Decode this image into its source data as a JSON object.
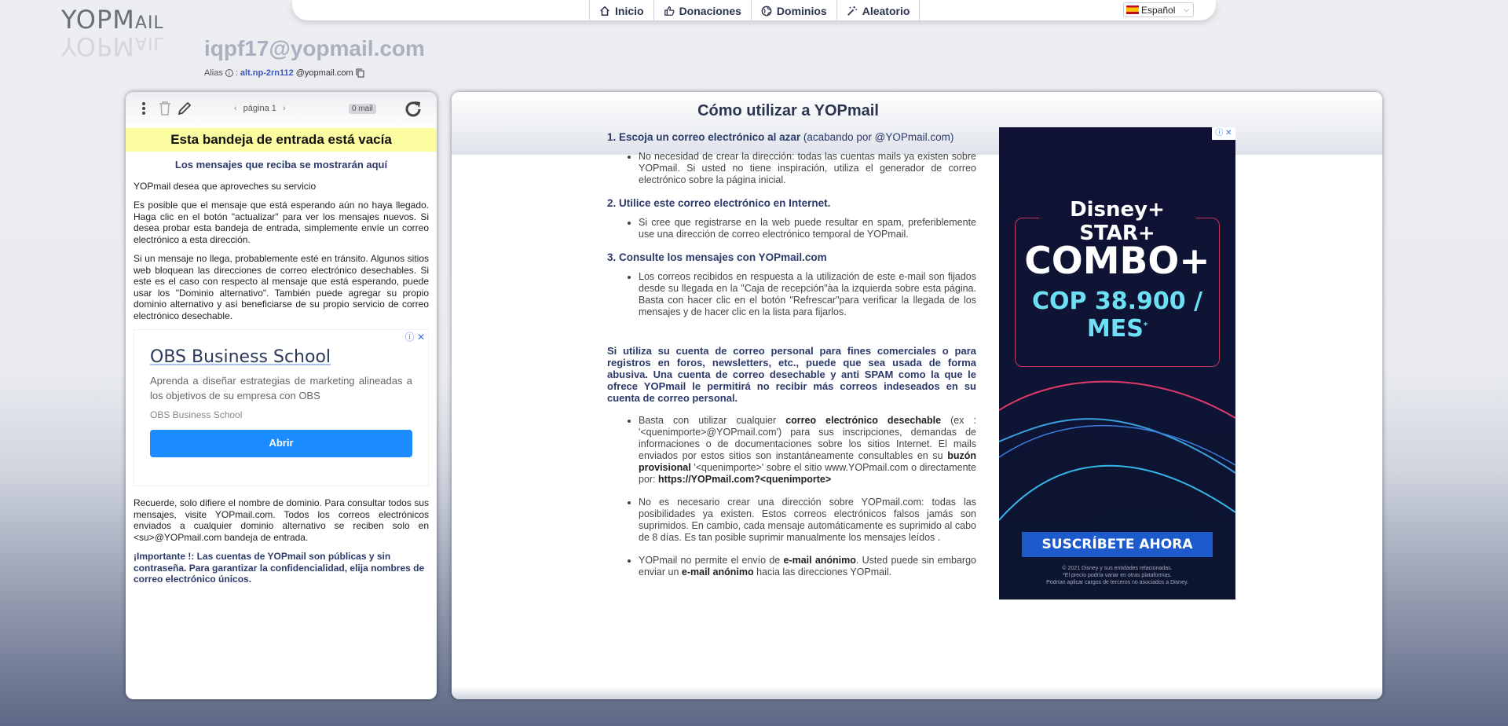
{
  "logo": {
    "text_main": "YOPM",
    "text_small": "AIL"
  },
  "nav": {
    "items": [
      {
        "label": "Inicio",
        "icon": "home-icon"
      },
      {
        "label": "Donaciones",
        "icon": "thumbs-up-icon"
      },
      {
        "label": "Dominios",
        "icon": "globe-icon"
      },
      {
        "label": "Aleatorio",
        "icon": "magic-wand-icon"
      }
    ],
    "language": "Español"
  },
  "mailbox": {
    "address": "iqpf17@yopmail.com",
    "alias_label": "Alias",
    "alias_sep": ":",
    "alias_name": "alt.np-2rn112",
    "alias_domain": "@yopmail.com"
  },
  "inbox": {
    "page_label": "página 1",
    "mail_count": "0 mail",
    "empty_banner": "Esta bandeja de entrada está vacía",
    "subtitle": "Los mensajes que reciba se mostrarán aquí",
    "p1": "YOPmail desea que aproveches su servicio",
    "p2": "Es posible que el mensaje que está esperando aún no haya llegado. Haga clic en el botón \"actualizar\" para ver los mensajes nuevos. Si desea probar esta bandeja de entrada, simplemente envíe un correo electrónico a esta dirección.",
    "p3": "Si un mensaje no llega, probablemente esté en tránsito. Algunos sitios web bloquean las direcciones de correo electrónico desechables. Si este es el caso con respecto al mensaje que está esperando, puede usar los \"Dominio alternativo\". También puede agregar su propio dominio alternativo y así beneficiarse de su propio servicio de correo electrónico desechable.",
    "p4": "Recuerde, solo difiere el nombre de dominio. Para consultar todos sus mensajes, visite YOPmail.com. Todos los correos electrónicos enviados a cualquier dominio alternativo se reciben solo en <su>@YOPmail.com bandeja de entrada.",
    "important": "¡Importante !: Las cuentas de YOPmail son públicas y sin contraseña. Para garantizar la confidencialidad, elija nombres de correo electrónico únicos."
  },
  "ad_small": {
    "title": "OBS Business School",
    "description": "Aprenda a diseñar estrategias de marketing alineadas a los objetivos de su empresa con OBS",
    "source": "OBS Business School",
    "button": "Abrir"
  },
  "howto": {
    "title": "Cómo utilizar a YOPmail",
    "step1_bold": "1. Escoja un correo electrónico al azar",
    "step1_rest": " (acabando por @YOPmail.com)",
    "step1_item": "No necesidad de crear la dirección: todas las cuentas mails ya existen sobre YOPmail. Si usted no tiene inspiración, utiliza el generador de correo electrónico sobre la página inicial.",
    "step2": "2. Utilice este correo electrónico en Internet.",
    "step2_item": "Si cree que registrarse en la web puede resultar en spam, preferiblemente use una dirección de correo electrónico temporal de YOPmail.",
    "step3": "3. Consulte los mensajes con YOPmail.com",
    "step3_item": "Los correos recibidos en respuesta a la utilización de este e-mail son fijados desde su llegada en la \"Caja de recepción\"àa la izquierda sobre esta página. Basta con hacer clic en el botón \"Refrescar\"para verificar la llegada de los mensajes y de hacer clic en la lista para fijarlos.",
    "warning": "Si utiliza su cuenta de correo personal para fines comerciales o para registros en foros, newsletters, etc., puede que sea usada de forma abusiva. Una cuenta de correo desechable y anti SPAM como la que le ofrece YOPmail le permitirá no recibir más correos indeseados en su cuenta de correo personal.",
    "b1_a": "Basta con utilizar cualquier ",
    "b1_b": "correo electrónico desechable",
    "b1_c": " (ex : '<quenimporte>@YOPmail.com') para sus inscripciones, demandas de informaciones o de documentaciones sobre los sitios Internet. El mails enviados por estos sitios son instantáneamente consultables en su ",
    "b1_d": "buzón provisional",
    "b1_e": " '<quenimporte>' sobre el sitio www.YOPmail.com o directamente por: ",
    "b1_f": "https://YOPmail.com?<quenimporte>",
    "b2": "No es necesario crear una dirección sobre YOPmail.com: todas las posibilidades ya existen. Estos correos electrónicos falsos jamás son suprimidos. En cambio, cada mensaje automáticamente es suprimido al cabo de 8 días. Es tan posible suprimir manualmente los mensajes leídos .",
    "b3_a": "YOPmail no permite el envío de ",
    "b3_b": "e-mail anónimo",
    "b3_c": ". Usted puede sin embargo enviar un ",
    "b3_d": "e-mail anónimo",
    "b3_e": " hacia las direcciones YOPmail."
  },
  "ad_big": {
    "brand": "Disney+ STAR+",
    "headline": "COMBO+",
    "price": "COP 38.900 / MES",
    "price_mark": "*",
    "cta": "SUSCRÍBETE AHORA",
    "legal1": "© 2021 Disney y sus entidades relacionadas.",
    "legal2": "*El precio podría variar en otras plataformas.",
    "legal3": "Podrían aplicar cargos de terceros no asociados a Disney."
  },
  "colors": {
    "accent_dark": "#2c3550",
    "link_blue": "#3b57b8",
    "banner_yellow": "#fcfca1",
    "button_blue": "#1a8cff"
  }
}
